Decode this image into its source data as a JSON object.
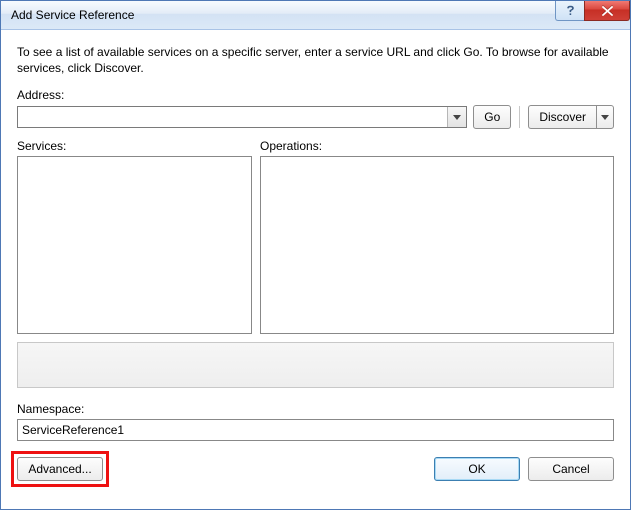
{
  "window": {
    "title": "Add Service Reference"
  },
  "instructions": "To see a list of available services on a specific server, enter a service URL and click Go. To browse for available services, click Discover.",
  "address": {
    "label": "Address:",
    "value": "",
    "go_label": "Go",
    "discover_label": "Discover"
  },
  "services": {
    "label": "Services:"
  },
  "operations": {
    "label": "Operations:"
  },
  "namespace": {
    "label": "Namespace:",
    "value": "ServiceReference1"
  },
  "buttons": {
    "advanced": "Advanced...",
    "ok": "OK",
    "cancel": "Cancel"
  }
}
